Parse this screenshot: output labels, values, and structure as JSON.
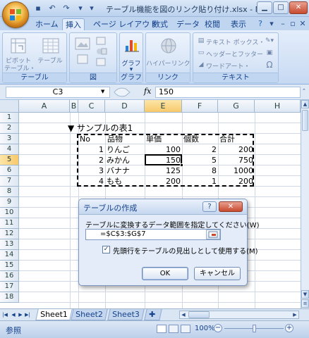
{
  "window": {
    "title": "テーブル機能を図のリンク貼り付け.xlsx - M..."
  },
  "ribbon_tabs": [
    {
      "label": "ホーム"
    },
    {
      "label": "挿入"
    },
    {
      "label": "ページ レイアウト"
    },
    {
      "label": "数式"
    },
    {
      "label": "データ"
    },
    {
      "label": "校閲"
    },
    {
      "label": "表示"
    }
  ],
  "ribbon": {
    "groups": {
      "table": "テーブル",
      "figure": "図",
      "chart": "グラフ",
      "link": "リンク",
      "text": "テキスト"
    },
    "buttons": {
      "pivot_table": "ピボット\nテーブル",
      "pivot_table_line1": "ピボット",
      "pivot_table_line2": "テーブル・",
      "table": "テーブル",
      "chart": "グラフ",
      "hyperlink": "ハイパーリンク",
      "text_box": "テキスト ボックス・",
      "header_footer": "ヘッダーとフッター",
      "wordart": "ワードアート・",
      "omega": "Ω"
    }
  },
  "formula_bar": {
    "name_box": "C3",
    "fx_label": "fx",
    "formula": "150"
  },
  "columns": [
    "A",
    "B",
    "C",
    "D",
    "E",
    "F",
    "G",
    "H"
  ],
  "rows": [
    "1",
    "2",
    "3",
    "4",
    "5",
    "6",
    "7",
    "8",
    "9",
    "10",
    "11",
    "12",
    "13",
    "14",
    "15",
    "16",
    "17",
    "18"
  ],
  "cells": {
    "title": "▼ サンプルの表1",
    "headers": [
      "No",
      "品物",
      "単価",
      "個数",
      "合計"
    ],
    "data": [
      [
        "1",
        "りんご",
        "100",
        "2",
        "200"
      ],
      [
        "2",
        "みかん",
        "150",
        "5",
        "750"
      ],
      [
        "3",
        "バナナ",
        "125",
        "8",
        "1000"
      ],
      [
        "4",
        "もも",
        "200",
        "1",
        "200"
      ]
    ]
  },
  "sheets": [
    {
      "label": "Sheet1"
    },
    {
      "label": "Sheet2"
    },
    {
      "label": "Sheet3"
    }
  ],
  "status": {
    "mode": "参照",
    "zoom": "100%"
  },
  "dialog": {
    "title": "テーブルの作成",
    "help": "?",
    "close": "✕",
    "prompt": "テーブルに変換するデータ範囲を指定してください(W)",
    "range_value": "=$C$3:$G$7",
    "range_display": "$C$3:$G$7",
    "checkbox_label": "先頭行をテーブルの見出しとして使用する(M)",
    "checkbox_checked": "✓",
    "ok": "OK",
    "cancel": "キャンセル"
  },
  "colors": {
    "accent": "#15428b",
    "selected_header": "#f8c96b",
    "close_red": "#c74a2e"
  }
}
